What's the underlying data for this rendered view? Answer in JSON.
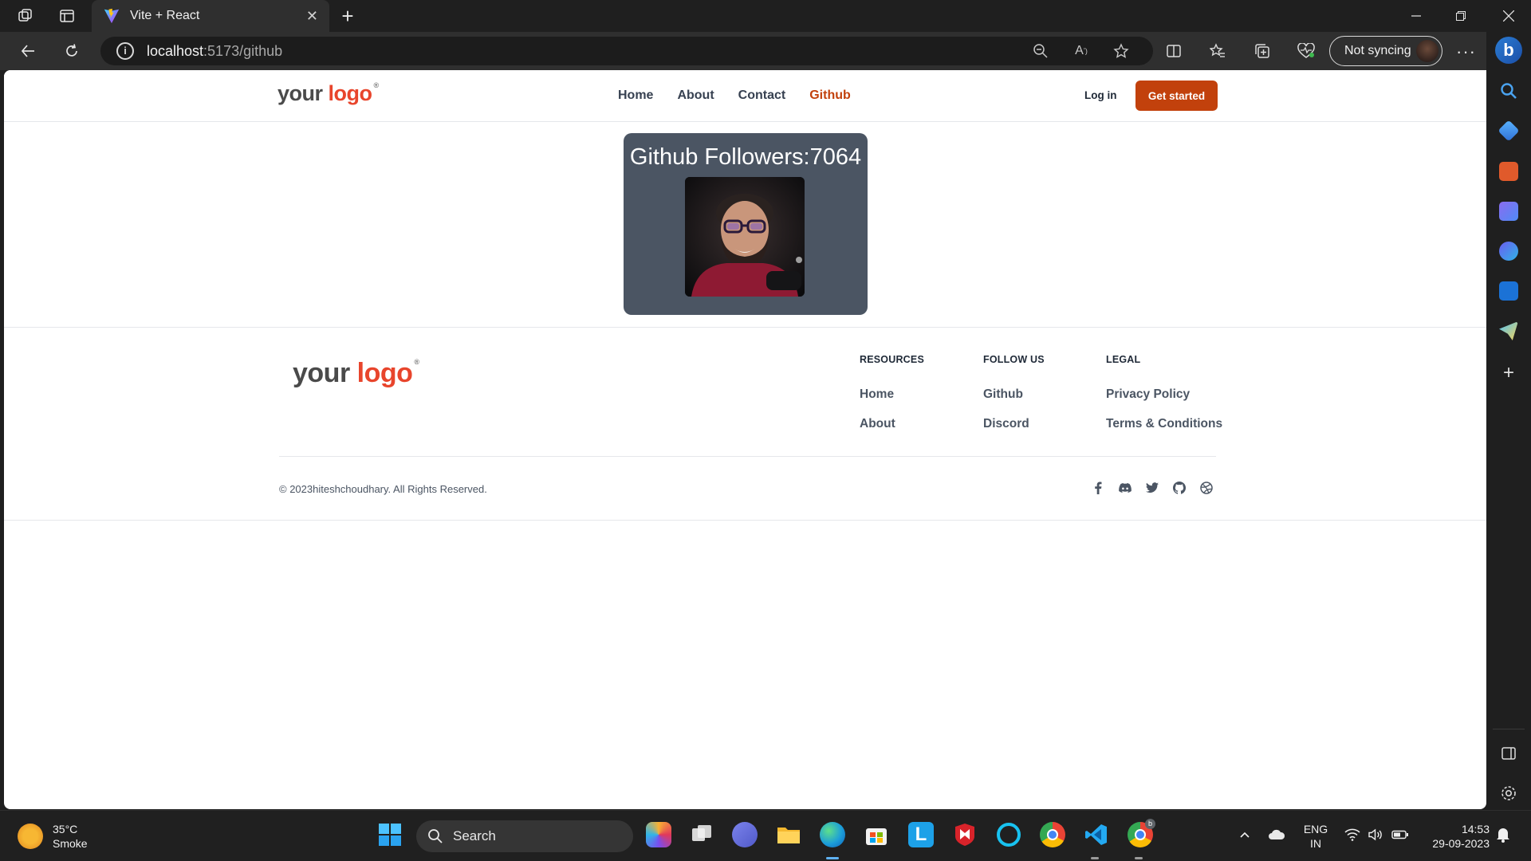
{
  "browser": {
    "tab_title": "Vite + React",
    "url_host": "localhost",
    "url_path": ":5173/github",
    "sync_label": "Not syncing"
  },
  "site": {
    "logo_part1": "your",
    "logo_part2": "logo",
    "logo_mark": "®",
    "nav": {
      "home": "Home",
      "about": "About",
      "contact": "Contact",
      "github": "Github"
    },
    "login_label": "Log in",
    "cta_label": "Get started"
  },
  "github": {
    "followers_label": "Github Followers:",
    "followers_count": "7064"
  },
  "footer": {
    "resources": {
      "title": "RESOURCES",
      "links": [
        "Home",
        "About"
      ]
    },
    "follow": {
      "title": "FOLLOW US",
      "links": [
        "Github",
        "Discord"
      ]
    },
    "legal": {
      "title": "LEGAL",
      "links": [
        "Privacy Policy",
        "Terms & Conditions"
      ]
    },
    "copyright": "© 2023hiteshchoudhary. All Rights Reserved.",
    "social_icons": [
      "facebook-icon",
      "discord-icon",
      "twitter-icon",
      "github-icon",
      "dribbble-icon"
    ]
  },
  "taskbar": {
    "weather_temp": "35°C",
    "weather_desc": "Smoke",
    "search_placeholder": "Search",
    "lang_line1": "ENG",
    "lang_line2": "IN",
    "time": "14:53",
    "date": "29-09-2023"
  },
  "colors": {
    "accent": "#c2410c",
    "card_bg": "#4b5563",
    "logo_red": "#e8452c"
  }
}
